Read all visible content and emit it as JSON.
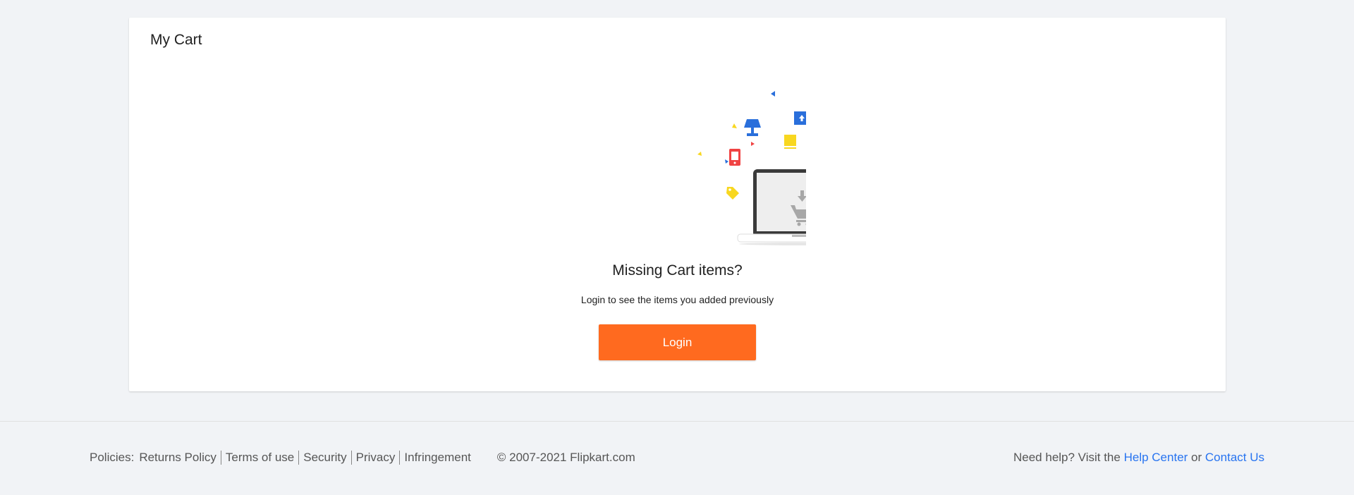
{
  "cart": {
    "title": "My Cart",
    "empty_heading": "Missing Cart items?",
    "empty_subtext": "Login to see the items you added previously",
    "login_label": "Login"
  },
  "colors": {
    "accent": "#ff6a1f",
    "link": "#2874f0",
    "illustration_blue": "#2a6fdb",
    "illustration_red": "#f04343",
    "illustration_yellow": "#f8d720"
  },
  "illustration": {
    "icons": [
      "lamp-icon",
      "tv-icon",
      "book-icon",
      "phone-icon",
      "tshirt-icon",
      "tag-icon",
      "car-icon",
      "laptop-icon",
      "cart-icon",
      "download-arrow-icon"
    ]
  },
  "footer": {
    "policies_label": "Policies:",
    "links": [
      "Returns Policy",
      "Terms of use",
      "Security",
      "Privacy",
      "Infringement"
    ],
    "copyright": "© 2007-2021 Flipkart.com",
    "help_prefix": "Need help? Visit the",
    "help_center": "Help Center",
    "or_text": "or",
    "contact_us": "Contact Us"
  }
}
